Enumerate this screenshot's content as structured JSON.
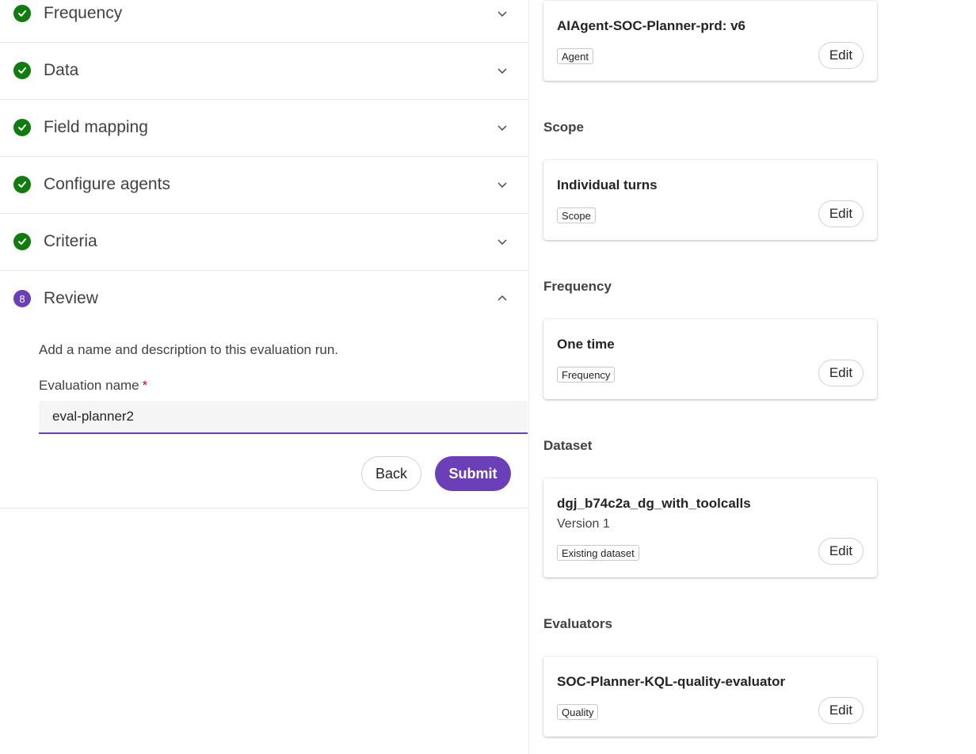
{
  "steps": [
    {
      "label": "Frequency",
      "status": "complete"
    },
    {
      "label": "Data",
      "status": "complete"
    },
    {
      "label": "Field mapping",
      "status": "complete"
    },
    {
      "label": "Configure agents",
      "status": "complete"
    },
    {
      "label": "Criteria",
      "status": "complete"
    },
    {
      "label": "Review",
      "status": "active",
      "number": "8"
    }
  ],
  "review": {
    "description": "Add a name and description to this evaluation run.",
    "name_label": "Evaluation name",
    "required_marker": "*",
    "name_value": "eval-planner2",
    "back_label": "Back",
    "submit_label": "Submit"
  },
  "summary": {
    "agent": {
      "title": "AIAgent-SOC-Planner-prd: v6",
      "tag": "Agent",
      "edit_label": "Edit"
    },
    "scope": {
      "heading": "Scope",
      "title": "Individual turns",
      "tag": "Scope",
      "edit_label": "Edit"
    },
    "frequency": {
      "heading": "Frequency",
      "title": "One time",
      "tag": "Frequency",
      "edit_label": "Edit"
    },
    "dataset": {
      "heading": "Dataset",
      "title": "dgj_b74c2a_dg_with_toolcalls",
      "subtitle": "Version 1",
      "tag": "Existing dataset",
      "edit_label": "Edit"
    },
    "evaluators": {
      "heading": "Evaluators",
      "title": "SOC-Planner-KQL-quality-evaluator",
      "tag": "Quality",
      "edit_label": "Edit"
    }
  },
  "colors": {
    "complete": "#107c10",
    "accent": "#6b3fb8",
    "required": "#c50f1f"
  },
  "icons": {
    "complete": "checkmark-circle-icon",
    "collapsed": "chevron-down-icon",
    "expanded": "chevron-up-icon"
  }
}
